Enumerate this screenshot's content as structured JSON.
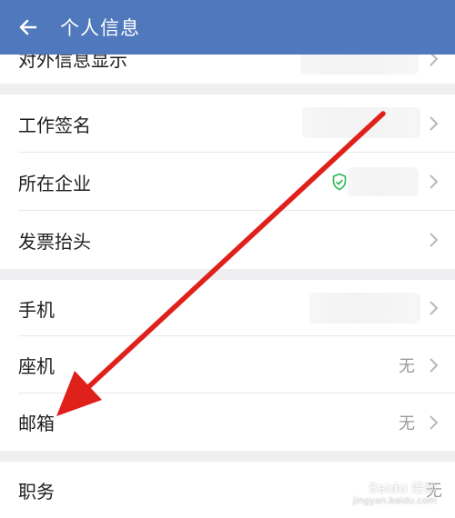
{
  "header": {
    "title": "个人信息"
  },
  "rows": {
    "external_info": {
      "label": "对外信息显示"
    },
    "work_signature": {
      "label": "工作签名"
    },
    "company": {
      "label": "所在企业"
    },
    "invoice_title": {
      "label": "发票抬头"
    },
    "mobile": {
      "label": "手机"
    },
    "landline": {
      "label": "座机",
      "value": "无"
    },
    "email": {
      "label": "邮箱",
      "value": "无"
    },
    "position": {
      "label": "职务",
      "value": "无"
    }
  },
  "colors": {
    "header": "#4f78bd",
    "arrow": "#e0201a",
    "verified": "#2fb65a"
  },
  "icons": {
    "back": "back-arrow-icon",
    "chevron": "chevron-right-icon",
    "verified": "verified-shield-icon"
  }
}
